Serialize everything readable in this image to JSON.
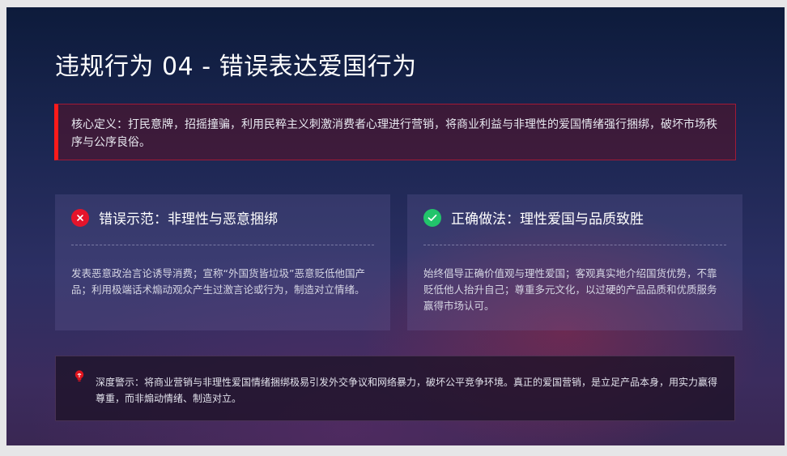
{
  "slide": {
    "title": "违规行为 04 - 错误表达爱国行为",
    "definition": "核心定义：打民意牌，招摇撞骗，利用民粹主义刺激消费者心理进行营销，将商业利益与非理性的爱国情绪强行捆绑，破坏市场秩序与公序良俗。",
    "wrong_card": {
      "title": "错误示范：非理性与恶意捆绑",
      "body": "发表恶意政治言论诱导消费；宣称“外国货皆垃圾”恶意贬低他国产品；利用极端话术煽动观众产生过激言论或行为，制造对立情绪。",
      "icon": "x-circle-icon"
    },
    "right_card": {
      "title": "正确做法：理性爱国与品质致胜",
      "body": "始终倡导正确价值观与理性爱国；客观真实地介绍国货优势，不靠贬低他人抬升自己；尊重多元文化，以过硬的产品品质和优质服务赢得市场认可。",
      "icon": "check-circle-icon"
    },
    "warning": {
      "text": "深度警示：将商业营销与非理性爱国情绪捆绑极易引发外交争议和网络暴力，破坏公平竞争环境。真正的爱国营销，是立足产品本身，用实力赢得尊重，而非煽动情绪、制造对立。",
      "icon": "bulb-icon"
    },
    "colors": {
      "accent_red": "#ff1a1a",
      "wrong_badge": "#e5142b",
      "right_badge": "#22c46b",
      "background_top": "#0d1b3b",
      "background_bottom": "#3a2753"
    }
  }
}
